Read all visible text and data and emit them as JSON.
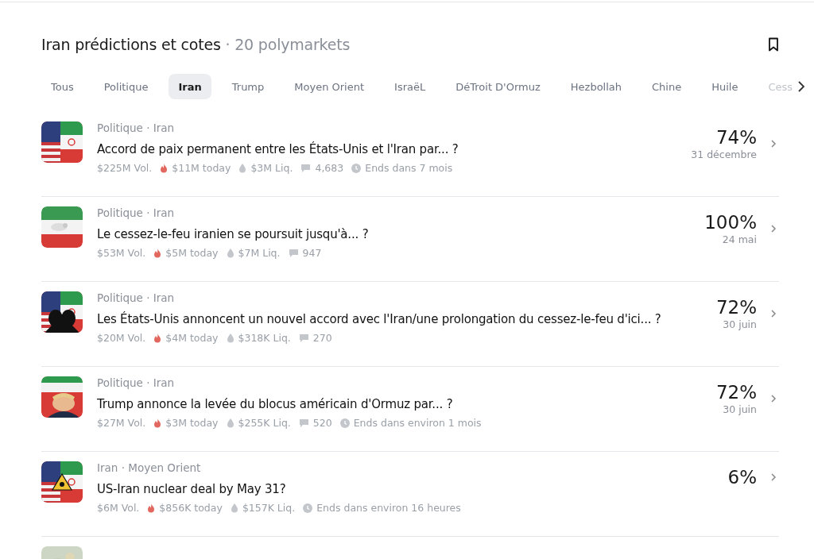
{
  "header": {
    "title": "Iran prédictions et cotes",
    "count": "· 20 polymarkets"
  },
  "tabs": [
    {
      "label": "Tous",
      "selected": false
    },
    {
      "label": "Politique",
      "selected": false
    },
    {
      "label": "Iran",
      "selected": true
    },
    {
      "label": "Trump",
      "selected": false
    },
    {
      "label": "Moyen Orient",
      "selected": false
    },
    {
      "label": "IsraëL",
      "selected": false
    },
    {
      "label": "DéTroit D'Ormuz",
      "selected": false
    },
    {
      "label": "Hezbollah",
      "selected": false
    },
    {
      "label": "Chine",
      "selected": false
    },
    {
      "label": "Huile",
      "selected": false
    },
    {
      "label": "Cess",
      "selected": false
    }
  ],
  "markets": [
    {
      "thumb": {
        "kind": "picture"
      },
      "tags": "Politique · Iran",
      "question": "Accord de paix permanent entre les États-Unis et l'Iran par... ?",
      "chance": "74%",
      "date": "31 décembre",
      "stats": [
        {
          "kind": "volume",
          "text": "$225M Vol."
        },
        {
          "kind": "today",
          "text": "$11M today"
        },
        {
          "kind": "liquidity",
          "text": "$3M Liq."
        },
        {
          "kind": "comments",
          "text": "4,683"
        },
        {
          "kind": "ends",
          "text": "Ends dans 7 mois"
        }
      ]
    },
    {
      "thumb": {
        "kind": "picture"
      },
      "tags": "Politique · Iran",
      "question": "Le cessez-le-feu iranien se poursuit jusqu'à... ?",
      "chance": "100%",
      "date": "24 mai",
      "stats": [
        {
          "kind": "volume",
          "text": "$53M Vol."
        },
        {
          "kind": "today",
          "text": "$5M today"
        },
        {
          "kind": "liquidity",
          "text": "$7M Liq."
        },
        {
          "kind": "comments",
          "text": "947"
        }
      ]
    },
    {
      "thumb": {
        "kind": "picture"
      },
      "tags": "Politique · Iran",
      "question": "Les États-Unis annoncent un nouvel accord avec l'Iran/une prolongation du cessez-le-feu d'ici... ?",
      "chance": "72%",
      "date": "30 juin",
      "stats": [
        {
          "kind": "volume",
          "text": "$20M Vol."
        },
        {
          "kind": "today",
          "text": "$4M today"
        },
        {
          "kind": "liquidity",
          "text": "$318K Liq."
        },
        {
          "kind": "comments",
          "text": "270"
        }
      ]
    },
    {
      "thumb": {
        "kind": "picture"
      },
      "tags": "Politique · Iran",
      "question": "Trump annonce la levée du blocus américain d'Ormuz par... ?",
      "chance": "72%",
      "date": "30 juin",
      "stats": [
        {
          "kind": "volume",
          "text": "$27M Vol."
        },
        {
          "kind": "today",
          "text": "$3M today"
        },
        {
          "kind": "liquidity",
          "text": "$255K Liq."
        },
        {
          "kind": "comments",
          "text": "520"
        },
        {
          "kind": "ends",
          "text": "Ends dans environ 1 mois"
        }
      ]
    },
    {
      "thumb": {
        "kind": "picture"
      },
      "tags": "Iran · Moyen Orient",
      "question": "US-Iran nuclear deal by May 31?",
      "chance": "6%",
      "stats": [
        {
          "kind": "volume",
          "text": "$6M Vol."
        },
        {
          "kind": "today",
          "text": "$856K today"
        },
        {
          "kind": "liquidity",
          "text": "$157K Liq."
        },
        {
          "kind": "ends",
          "text": "Ends dans environ 16 heures"
        }
      ]
    },
    {
      "thumb": {
        "kind": "picture"
      }
    }
  ]
}
